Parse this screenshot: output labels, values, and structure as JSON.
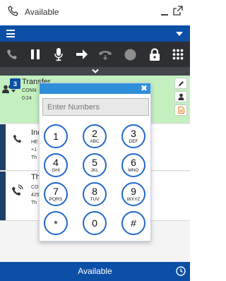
{
  "title_bar": {
    "status": "Available",
    "icons": [
      "phone-icon",
      "minimize-icon",
      "popout-icon"
    ]
  },
  "top_bar": {
    "icons": [
      "hamburger-menu-icon",
      "dropdown-caret-icon"
    ]
  },
  "toolbar": {
    "icons": [
      "phone-icon",
      "pause-icon",
      "microphone-icon",
      "transfer-arrow-icon",
      "hangup-icon",
      "record-dot-icon",
      "lock-icon",
      "keypad-grid-icon"
    ]
  },
  "interactions": [
    {
      "badge": "3",
      "name": "Transfer",
      "detail_line1": "CONN",
      "detail_line2": "0:24",
      "state": "active"
    },
    {
      "name": "Inc",
      "detail_line1": "HE",
      "detail_line2": "+1",
      "detail_line3": "Th"
    },
    {
      "name": "Th",
      "detail_line1": "CO",
      "detail_line2": "425",
      "detail_line3": "Th"
    }
  ],
  "dialpad": {
    "placeholder": "Enter Numbers",
    "keys": [
      {
        "digit": "1",
        "letters": ""
      },
      {
        "digit": "2",
        "letters": "ABC"
      },
      {
        "digit": "3",
        "letters": "DEF"
      },
      {
        "digit": "4",
        "letters": "GHI"
      },
      {
        "digit": "5",
        "letters": "JKL"
      },
      {
        "digit": "6",
        "letters": "MNO"
      },
      {
        "digit": "7",
        "letters": "PQRS"
      },
      {
        "digit": "8",
        "letters": "TUV"
      },
      {
        "digit": "9",
        "letters": "WXYZ"
      },
      {
        "digit": "*",
        "letters": ""
      },
      {
        "digit": "0",
        "letters": ""
      },
      {
        "digit": "#",
        "letters": ""
      }
    ]
  },
  "footer": {
    "status": "Available"
  },
  "colors": {
    "primary_blue": "#0b4fa6",
    "toolbar_dark": "#2d2f33",
    "active_green": "#c4f0c0",
    "dialpad_header": "#2f8fd8",
    "key_ring": "#2268c7"
  }
}
